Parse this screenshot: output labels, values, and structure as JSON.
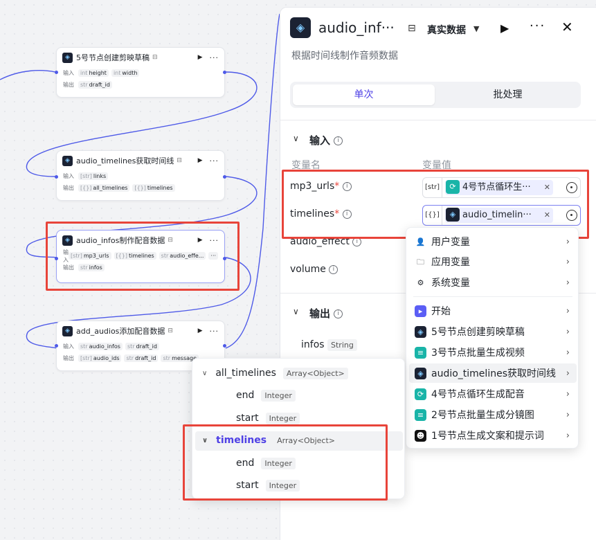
{
  "nodes": [
    {
      "title": "5号节点创建剪映草稿",
      "inputs": [
        [
          "int",
          "height"
        ],
        [
          "int",
          "width"
        ]
      ],
      "outputs": [
        [
          "str",
          "draft_id"
        ]
      ]
    },
    {
      "title": "audio_timelines获取时间线",
      "inputs": [
        [
          "[str]",
          "links"
        ]
      ],
      "outputs": [
        [
          "[{}]",
          "all_timelines"
        ],
        [
          "[{}]",
          "timelines"
        ]
      ]
    },
    {
      "title": "audio_infos制作配音数据",
      "inputs": [
        [
          "[str]",
          "mp3_urls"
        ],
        [
          "[{}]",
          "timelines"
        ],
        [
          "str",
          "audio_effe..."
        ]
      ],
      "outputs": [
        [
          "str",
          "infos"
        ]
      ]
    },
    {
      "title": "add_audios添加配音数据",
      "inputs": [
        [
          "str",
          "audio_infos"
        ],
        [
          "str",
          "draft_id"
        ]
      ],
      "outputs": [
        [
          "[str]",
          "audio_ids"
        ],
        [
          "str",
          "draft_id"
        ],
        [
          "str",
          "message"
        ]
      ]
    }
  ],
  "node_labels": {
    "input": "输入",
    "output": "输出",
    "more": "···"
  },
  "panel": {
    "title": "audio_inf···",
    "mode": "真实数据",
    "description": "根据时间线制作音频数据",
    "tabs": {
      "single": "单次",
      "batch": "批处理"
    },
    "input_section": "输入",
    "col_name": "变量名",
    "col_value": "变量值",
    "fields": [
      {
        "name": "mp3_urls",
        "type": "[str]",
        "ref": "4号节点循环生···",
        "ref_color": "#19b4a8"
      },
      {
        "name": "timelines",
        "type": "[{}]",
        "ref": "audio_timelin···",
        "ref_color": "#1b2233"
      },
      {
        "name": "audio_effect"
      },
      {
        "name": "volume"
      }
    ],
    "output_section": "输出",
    "outputs": [
      {
        "name": "infos",
        "type": "String"
      }
    ]
  },
  "menu": {
    "items": [
      {
        "label": "用户变量",
        "icon": "user-icon"
      },
      {
        "label": "应用变量",
        "icon": "folder-icon"
      },
      {
        "label": "系统变量",
        "icon": "gear-icon"
      },
      {
        "label": "开始",
        "icon": "start-icon",
        "color": "#5b5ef5"
      },
      {
        "label": "5号节点创建剪映草稿",
        "icon": "node-icon",
        "color": "#1b2233"
      },
      {
        "label": "3号节点批量生成视频",
        "icon": "batch-icon",
        "color": "#19b4a8"
      },
      {
        "label": "audio_timelines获取时间线",
        "icon": "node-icon",
        "color": "#1b2233"
      },
      {
        "label": "4号节点循环生成配音",
        "icon": "loop-icon",
        "color": "#19b4a8"
      },
      {
        "label": "2号节点批量生成分镜图",
        "icon": "batch-icon",
        "color": "#19b4a8"
      },
      {
        "label": "1号节点生成文案和提示词",
        "icon": "bot-icon",
        "color": "#111111"
      }
    ]
  },
  "tree": {
    "groups": [
      {
        "name": "all_timelines",
        "type": "Array<Object>",
        "children": [
          {
            "name": "end",
            "type": "Integer"
          },
          {
            "name": "start",
            "type": "Integer"
          }
        ]
      },
      {
        "name": "timelines",
        "type": "Array<Object>",
        "children": [
          {
            "name": "end",
            "type": "Integer"
          },
          {
            "name": "start",
            "type": "Integer"
          }
        ]
      }
    ]
  },
  "colors": {
    "accent": "#4e40e5",
    "highlight_box": "#e8443a",
    "wire": "#4e5ae8"
  }
}
